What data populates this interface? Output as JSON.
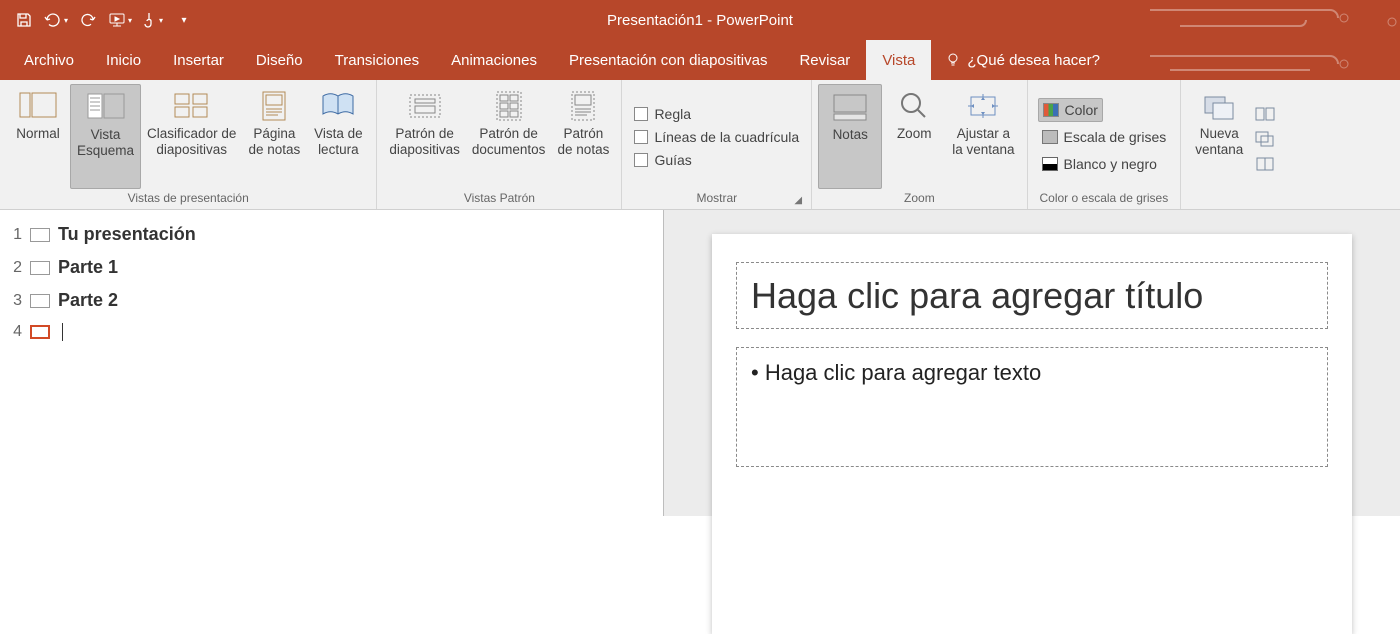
{
  "app": {
    "title": "Presentación1 - PowerPoint"
  },
  "qat": {
    "items": [
      "save-icon",
      "undo-icon",
      "redo-icon",
      "present-from-beginning-icon",
      "touch-mode-icon",
      "customize-qat-icon"
    ]
  },
  "tabs": {
    "items": [
      {
        "id": "archivo",
        "label": "Archivo"
      },
      {
        "id": "inicio",
        "label": "Inicio"
      },
      {
        "id": "insertar",
        "label": "Insertar"
      },
      {
        "id": "diseno",
        "label": "Diseño"
      },
      {
        "id": "transiciones",
        "label": "Transiciones"
      },
      {
        "id": "animaciones",
        "label": "Animaciones"
      },
      {
        "id": "presentacion",
        "label": "Presentación con diapositivas"
      },
      {
        "id": "revisar",
        "label": "Revisar"
      },
      {
        "id": "vista",
        "label": "Vista",
        "active": true
      }
    ],
    "tell_me_placeholder": "¿Qué desea hacer?"
  },
  "ribbon": {
    "groups": {
      "vistas_presentacion": {
        "label": "Vistas de presentación",
        "buttons": {
          "normal": "Normal",
          "esquema_l1": "Vista",
          "esquema_l2": "Esquema",
          "clasificador_l1": "Clasificador de",
          "clasificador_l2": "diapositivas",
          "pagina_notas_l1": "Página",
          "pagina_notas_l2": "de notas",
          "vista_lectura_l1": "Vista de",
          "vista_lectura_l2": "lectura"
        }
      },
      "vistas_patron": {
        "label": "Vistas Patrón",
        "buttons": {
          "patron_diap_l1": "Patrón de",
          "patron_diap_l2": "diapositivas",
          "patron_doc_l1": "Patrón de",
          "patron_doc_l2": "documentos",
          "patron_notas_l1": "Patrón",
          "patron_notas_l2": "de notas"
        }
      },
      "mostrar": {
        "label": "Mostrar",
        "items": {
          "regla": "Regla",
          "cuadricula": "Líneas de la cuadrícula",
          "guias": "Guías"
        }
      },
      "zoom": {
        "label": "Zoom",
        "buttons": {
          "notas": "Notas",
          "zoom": "Zoom",
          "ajustar_l1": "Ajustar a",
          "ajustar_l2": "la ventana"
        }
      },
      "color": {
        "label": "Color o escala de grises",
        "items": {
          "color": "Color",
          "grises": "Escala de grises",
          "bn": "Blanco y negro"
        }
      },
      "ventana": {
        "label": "",
        "buttons": {
          "nueva_l1": "Nueva",
          "nueva_l2": "ventana"
        }
      }
    }
  },
  "outline": {
    "items": [
      {
        "num": "1",
        "text": "Tu presentación"
      },
      {
        "num": "2",
        "text": "Parte 1"
      },
      {
        "num": "3",
        "text": "Parte 2"
      },
      {
        "num": "4",
        "text": ""
      }
    ]
  },
  "slide": {
    "title_placeholder": "Haga clic para agregar título",
    "body_placeholder": "Haga clic para agregar texto"
  }
}
